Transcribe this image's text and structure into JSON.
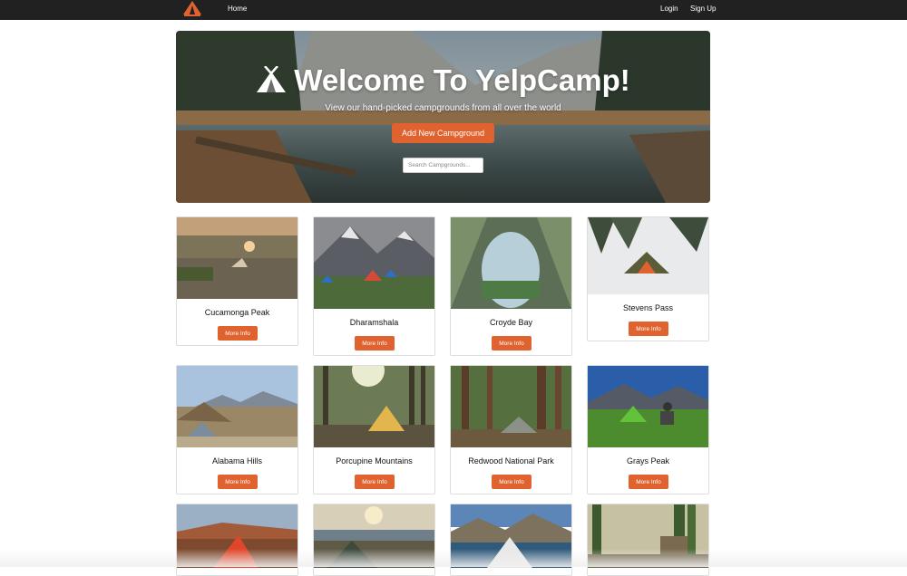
{
  "nav": {
    "home": "Home",
    "login": "Login",
    "signup": "Sign Up",
    "logo_icon": "tent-logo-icon"
  },
  "hero": {
    "title": "Welcome To YelpCamp!",
    "subtitle": "View our hand-picked campgrounds from all over the world",
    "add_button": "Add New Campground",
    "search_placeholder": "Search Campgrounds...",
    "title_icon": "tent-icon"
  },
  "colors": {
    "accent": "#e0622e",
    "navbar": "#212121"
  },
  "campgrounds": [
    {
      "name": "Cucamonga Peak",
      "button": "More Info"
    },
    {
      "name": "Dharamshala",
      "button": "More Info"
    },
    {
      "name": "Croyde Bay",
      "button": "More Info"
    },
    {
      "name": "Stevens Pass",
      "button": "More Info"
    },
    {
      "name": "Alabama Hills",
      "button": "More Info"
    },
    {
      "name": "Porcupine Mountains",
      "button": "More Info"
    },
    {
      "name": "Redwood National Park",
      "button": "More Info"
    },
    {
      "name": "Grays Peak",
      "button": "More Info"
    }
  ]
}
